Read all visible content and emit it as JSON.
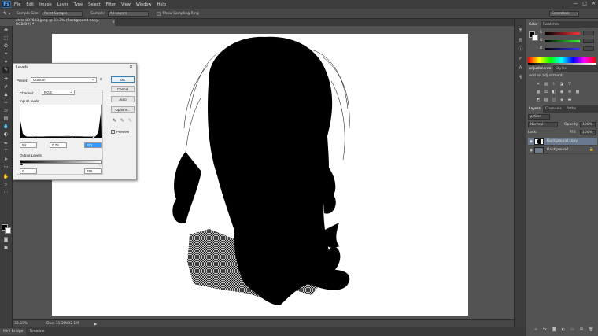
{
  "app": {
    "logo": "Ps"
  },
  "menu": [
    "File",
    "Edit",
    "Image",
    "Layer",
    "Type",
    "Select",
    "Filter",
    "View",
    "Window",
    "Help"
  ],
  "window_controls": {
    "minimize": "—",
    "maximize": "□",
    "close": "✕"
  },
  "options_bar": {
    "tool_icon": "eyedropper-icon",
    "sample_size_label": "Sample Size:",
    "sample_size_value": "Point Sample",
    "sample_label": "Sample:",
    "sample_value": "All Layers",
    "show_ring_label": "Show Sampling Ring",
    "workspace": "Essentials"
  },
  "document": {
    "tab_title": "child-807533.jpeg @ 33.3% (Background copy, RGB/8#) *",
    "close": "×"
  },
  "status": {
    "zoom": "33.33%",
    "doc_info": "Doc: 31.2M/92.1M"
  },
  "bottom_tabs": [
    "Mini Bridge",
    "Timeline"
  ],
  "levels": {
    "title": "Levels",
    "preset_label": "Preset:",
    "preset_value": "Custom",
    "channel_label": "Channel:",
    "channel_value": "RGB",
    "input_levels_label": "Input Levels:",
    "input_black": "54",
    "input_mid": "0.76",
    "input_white": "201",
    "output_levels_label": "Output Levels:",
    "output_black": "0",
    "output_white": "255",
    "buttons": {
      "ok": "OK",
      "cancel": "Cancel",
      "auto": "Auto",
      "options": "Options..."
    },
    "preview_label": "Preview",
    "preview_checked": true
  },
  "panels": {
    "color_tabs": [
      "Color",
      "Swatches"
    ],
    "color_channels": [
      "R",
      "G",
      "B"
    ],
    "adjust_tabs": [
      "Adjustments",
      "Styles"
    ],
    "adjust_heading": "Add an adjustment",
    "layers_tabs": [
      "Layers",
      "Channels",
      "Paths"
    ],
    "layers_kind": "ρ Kind",
    "blend_mode": "Normal",
    "opacity_label": "Opacity:",
    "opacity_value": "100%",
    "lock_label": "Lock:",
    "fill_label": "Fill:",
    "fill_value": "100%",
    "layers": [
      {
        "name": "Background copy",
        "selected": true
      },
      {
        "name": "Background",
        "selected": false
      }
    ]
  }
}
